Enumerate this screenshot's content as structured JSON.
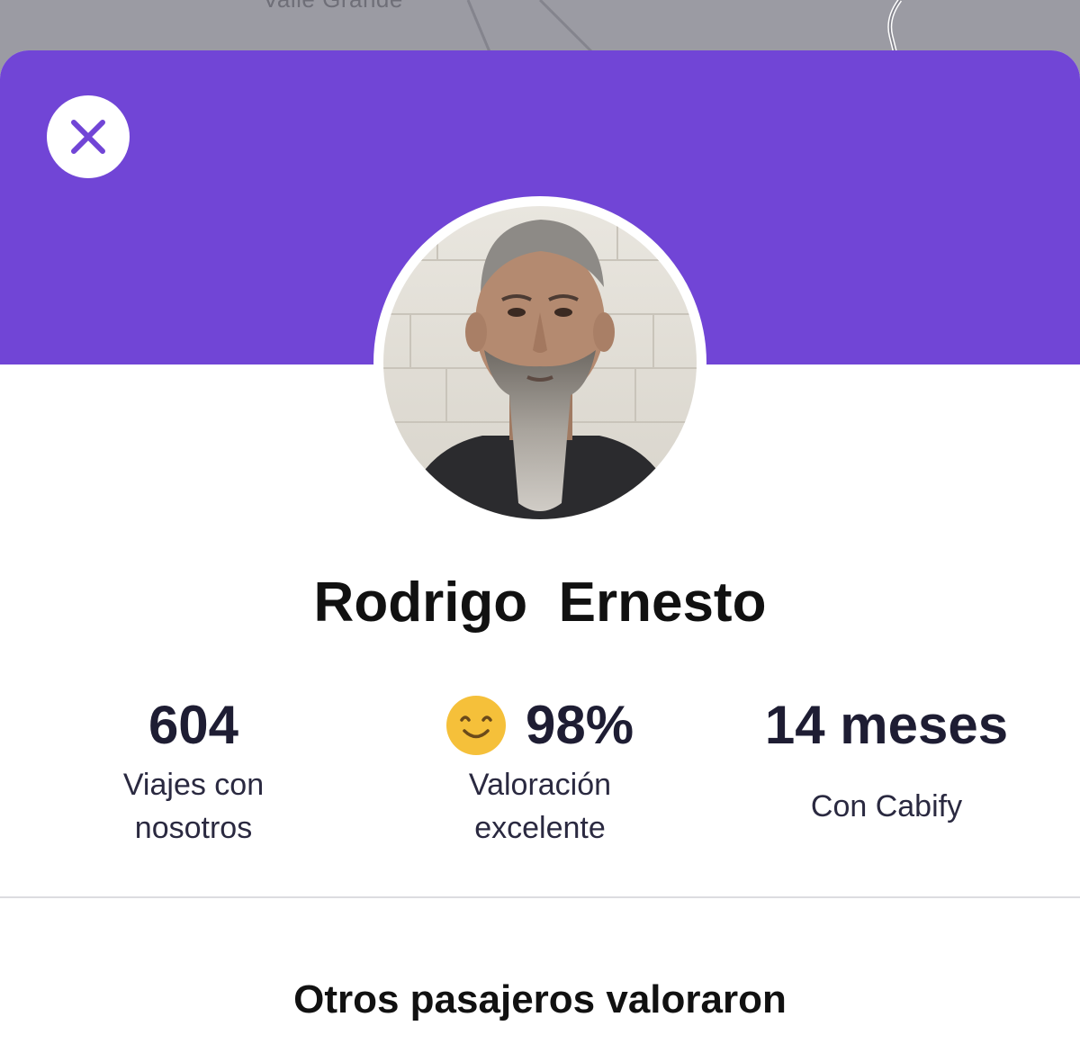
{
  "colors": {
    "brand_purple": "#7145d6",
    "rating_emoji_yellow": "#f5c03a",
    "text_dark": "#1e1d33"
  },
  "map": {
    "street_label": "Valle Grande"
  },
  "header": {
    "close_icon": "close-icon"
  },
  "driver": {
    "name": "Rodrigo  Ernesto"
  },
  "stats": {
    "trips": {
      "value": "604",
      "label": "Viajes con nosotros"
    },
    "rating": {
      "icon": "smiley-face-icon",
      "value": "98%",
      "label": "Valoración excelente"
    },
    "tenure": {
      "value": "14 meses",
      "label": "Con Cabify"
    }
  },
  "reviews": {
    "title": "Otros pasajeros valoraron"
  }
}
